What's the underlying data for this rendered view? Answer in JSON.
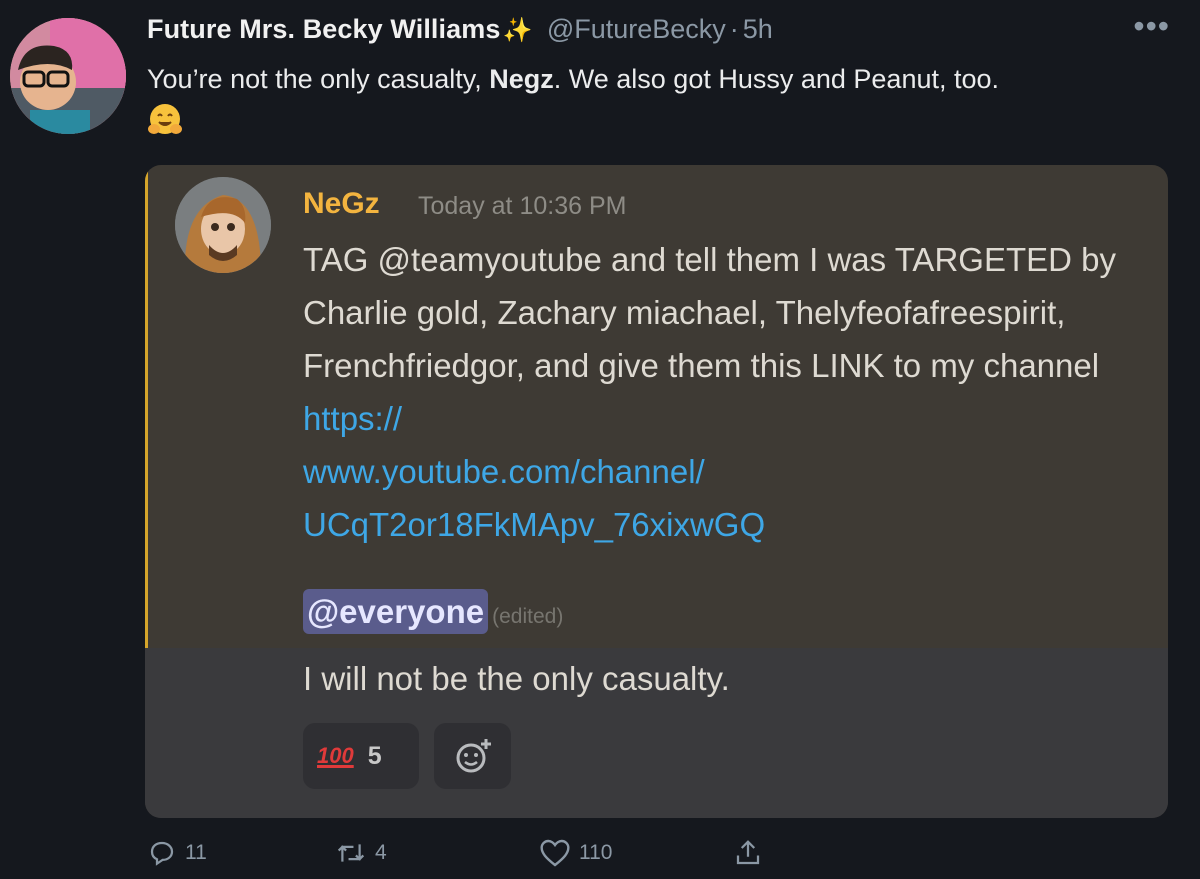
{
  "tweet": {
    "display_name": "Future Mrs. Becky Williams",
    "sparkle": "✨",
    "handle": "@FutureBecky",
    "separator": "·",
    "time": "5h",
    "more": "•••",
    "text_before": "You’re not the only casualty, ",
    "text_bold": "Negz",
    "text_after": ". We also got Hussy and Peanut, too."
  },
  "discord": {
    "username": "NeGz",
    "timestamp": "Today at 10:36 PM",
    "message": "TAG @teamyoutube and tell them I was TARGETED by Charlie gold, Zachary miachael, Thelyfeofafreespirit, Frenchfriedgor, and give them this LINK to my channel ",
    "link_line1": "https://",
    "link_line2": "www.youtube.com/channel/",
    "link_line3": "UCqT2or18FkMApv_76xixwGQ",
    "mention": "@everyone",
    "edited": "(edited)",
    "message2": "I will not be the only casualty.",
    "reaction_emoji": "100",
    "reaction_count": "5",
    "accent_color": "#d5a52b",
    "link_color": "#3ea7e6"
  },
  "actions": {
    "replies": "11",
    "retweets": "4",
    "likes": "110"
  }
}
